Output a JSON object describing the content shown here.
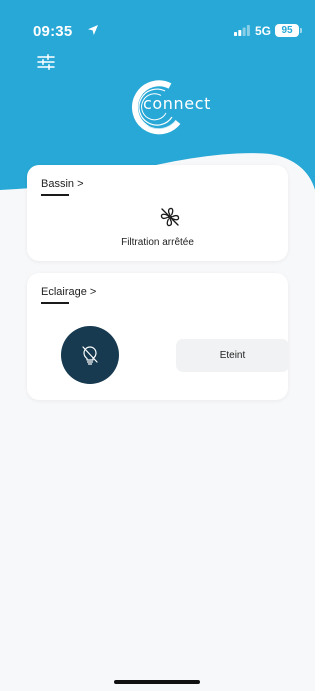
{
  "status_bar": {
    "time": "09:35",
    "network": "5G",
    "battery": "95",
    "location_icon": "location-arrow-icon",
    "signal_icon": "signal-bars-icon"
  },
  "header": {
    "settings_icon": "sliders-icon",
    "logo_text": "connect",
    "background_color": "#28a8d6"
  },
  "bassin": {
    "title": "Bassin >",
    "status_icon": "fan-off-icon",
    "status": "Filtration arrêtée"
  },
  "eclairage": {
    "title": "Eclairage >",
    "toggle_icon": "bulb-off-icon",
    "toggle_color": "#173a50",
    "state_label": "Eteint"
  }
}
